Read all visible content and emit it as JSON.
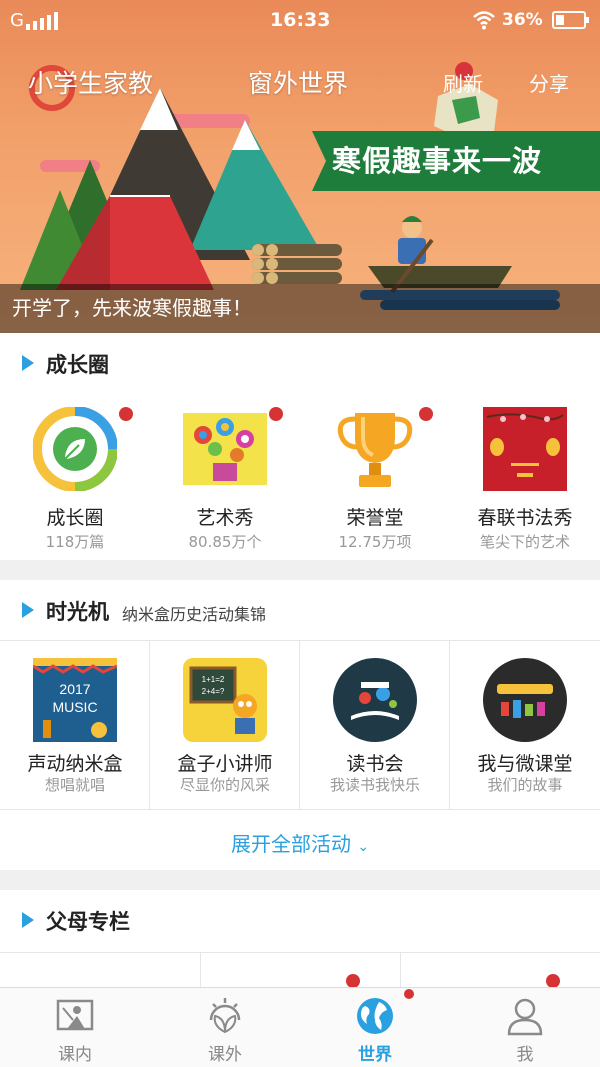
{
  "status_bar": {
    "carrier": "G",
    "time": "16:33",
    "battery_percent": "36%"
  },
  "top_nav": {
    "left_title": "小学生家教",
    "center_title": "窗外世界",
    "refresh": "刷新",
    "share": "分享"
  },
  "banner": {
    "ribbon_text": "寒假趣事来一波",
    "caption": "开学了，先来波寒假趣事！",
    "icons": [
      "map-icon"
    ],
    "colors": {
      "ribbon": "#1f7d3c",
      "sky": "#f2a06a"
    }
  },
  "growth_circle": {
    "title": "成长圈",
    "items": [
      {
        "label": "成长圈",
        "sub": "118万篇",
        "icon": "leaf-icon"
      },
      {
        "label": "艺术秀",
        "sub": "80.85万个",
        "icon": "flower-painting-icon"
      },
      {
        "label": "荣誉堂",
        "sub": "12.75万项",
        "icon": "trophy-icon"
      },
      {
        "label": "春联书法秀",
        "sub": "笔尖下的艺术",
        "icon": "lantern-icon"
      }
    ]
  },
  "time_machine": {
    "title": "时光机",
    "subtitle": "纳米盒历史活动集锦",
    "items": [
      {
        "label": "声动纳米盒",
        "sub": "想唱就唱",
        "poster_line1": "2017",
        "poster_line2": "MUSIC",
        "icon": "music-poster-icon"
      },
      {
        "label": "盒子小讲师",
        "sub": "尽显你的风采",
        "board_line1": "1+1=2",
        "board_line2": "2+4=?",
        "icon": "blackboard-icon"
      },
      {
        "label": "读书会",
        "sub": "我读书我快乐",
        "icon": "reading-icon"
      },
      {
        "label": "我与微课堂",
        "sub": "我们的故事",
        "icon": "microclass-icon"
      }
    ],
    "expand_label": "展开全部活动"
  },
  "parents_column": {
    "title": "父母专栏"
  },
  "tabbar": {
    "tabs": [
      {
        "label": "课内",
        "icon": "classroom-icon"
      },
      {
        "label": "课外",
        "icon": "sun-leaf-icon"
      },
      {
        "label": "世界",
        "icon": "globe-icon"
      },
      {
        "label": "我",
        "icon": "person-icon"
      }
    ],
    "active": "世界",
    "accent": "#2aa0e0"
  }
}
